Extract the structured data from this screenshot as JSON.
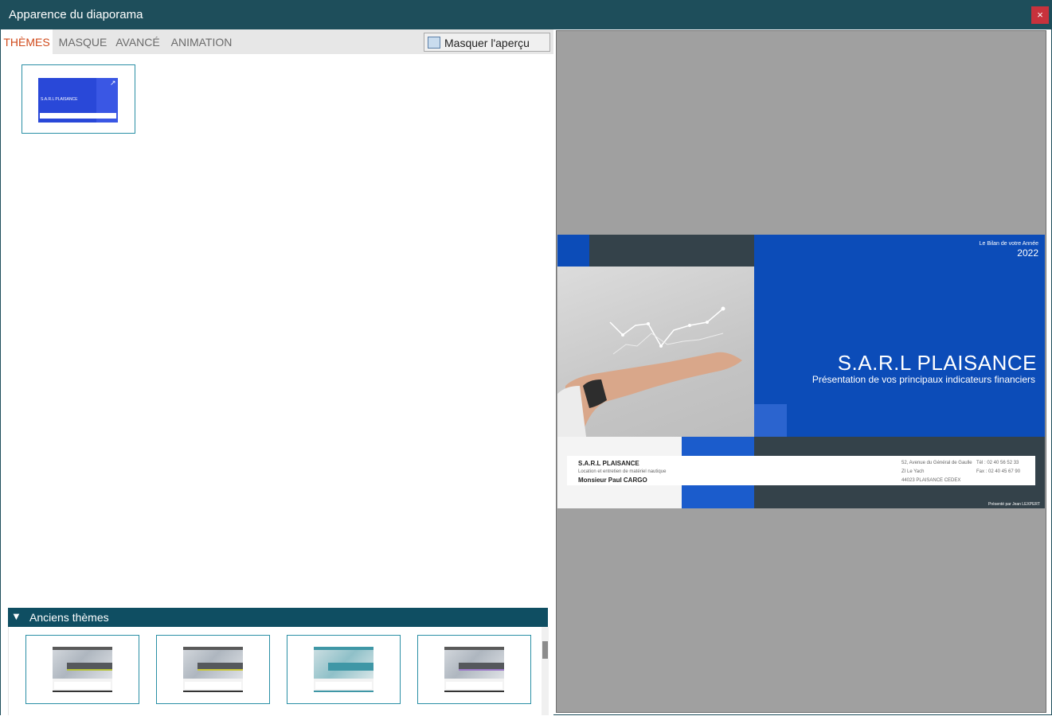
{
  "window": {
    "title": "Apparence du diaporama",
    "close_label": "×"
  },
  "tabs": [
    {
      "label": "THÈMES",
      "active": true
    },
    {
      "label": "MASQUE",
      "active": false
    },
    {
      "label": "AVANCÉ",
      "active": false
    },
    {
      "label": "ANIMATION",
      "active": false
    }
  ],
  "preview_toggle": {
    "label": "Masquer l'aperçu",
    "checked": false
  },
  "current_theme": {
    "thumb_title": "S.A.R.L PLAISANCE"
  },
  "old_themes": {
    "header": "Anciens thèmes",
    "expanded": true,
    "items": [
      {
        "stripe_color": "#b6c23a"
      },
      {
        "stripe_color": "#c9c63a"
      },
      {
        "stripe_color": "#3f97a6"
      },
      {
        "stripe_color": "#9b78c8"
      }
    ]
  },
  "slide_preview": {
    "top_subtitle": "Le Bilan de votre Année",
    "year": "2022",
    "title": "S.A.R.L PLAISANCE",
    "subtitle": "Présentation de vos principaux indicateurs financiers",
    "company_name": "S.A.R.L PLAISANCE",
    "company_activity": "Location et entretien de matériel nautique",
    "contact_name": "Monsieur Paul CARGO",
    "address_line1": "52, Avenue du Général de Gaulle",
    "address_line2": "ZI Le Yach",
    "address_line3": "44023 PLAISANCE CEDEX",
    "phone": "Tél : 02 40 56 52 33",
    "fax": "Fax : 02 40 45 67 90",
    "presented_by": "Présenté par Jean LEXPERT"
  },
  "colors": {
    "titlebar": "#1e4e5b",
    "tab_active_text": "#d04a1b",
    "accent_border": "#2a8fa5",
    "old_header_bg": "#0f4e62",
    "slide_blue": "#0c4cb8",
    "slide_dark": "#34424a"
  }
}
